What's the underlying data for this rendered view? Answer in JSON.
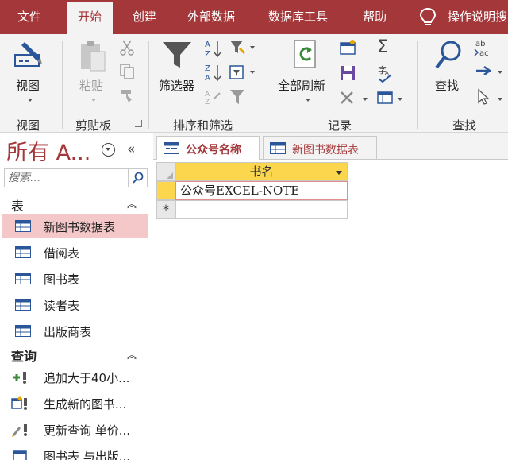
{
  "ribbon_tabs": [
    "文件",
    "开始",
    "创建",
    "外部数据",
    "数据库工具",
    "帮助"
  ],
  "active_tab": "开始",
  "tell_me": "操作说明搜",
  "groups": {
    "views": {
      "label": "视图",
      "view_button": "视图"
    },
    "clipboard": {
      "label": "剪贴板",
      "paste_button": "粘贴"
    },
    "sort_filter": {
      "label": "排序和筛选",
      "filter_button": "筛选器"
    },
    "records": {
      "label": "记录",
      "refresh_button": "全部刷新",
      "sum_symbol": "Σ"
    },
    "find": {
      "label": "查找",
      "find_button": "查找",
      "replace_symbol": "ab→ac"
    }
  },
  "nav_pane": {
    "title": "所有 A...",
    "search_placeholder": "搜索...",
    "sections": [
      {
        "title": "表",
        "items": [
          "新图书数据表",
          "借阅表",
          "图书表",
          "读者表",
          "出版商表"
        ]
      },
      {
        "title": "查询",
        "items": [
          "追加大于40小...",
          "生成新的图书...",
          "更新查询 单价...",
          "图书表 与出版..."
        ]
      }
    ],
    "selected_item": "新图书数据表"
  },
  "document_tabs": [
    "公众号名称",
    "新图书数据表"
  ],
  "active_document": "公众号名称",
  "datasheet": {
    "column": "书名",
    "rows": [
      "公众号EXCEL-NOTE"
    ],
    "new_row_marker": "*"
  },
  "colors": {
    "brand": "#a4373a",
    "header_highlight": "#fcd74d",
    "nav_selected": "#f4c7c8"
  }
}
